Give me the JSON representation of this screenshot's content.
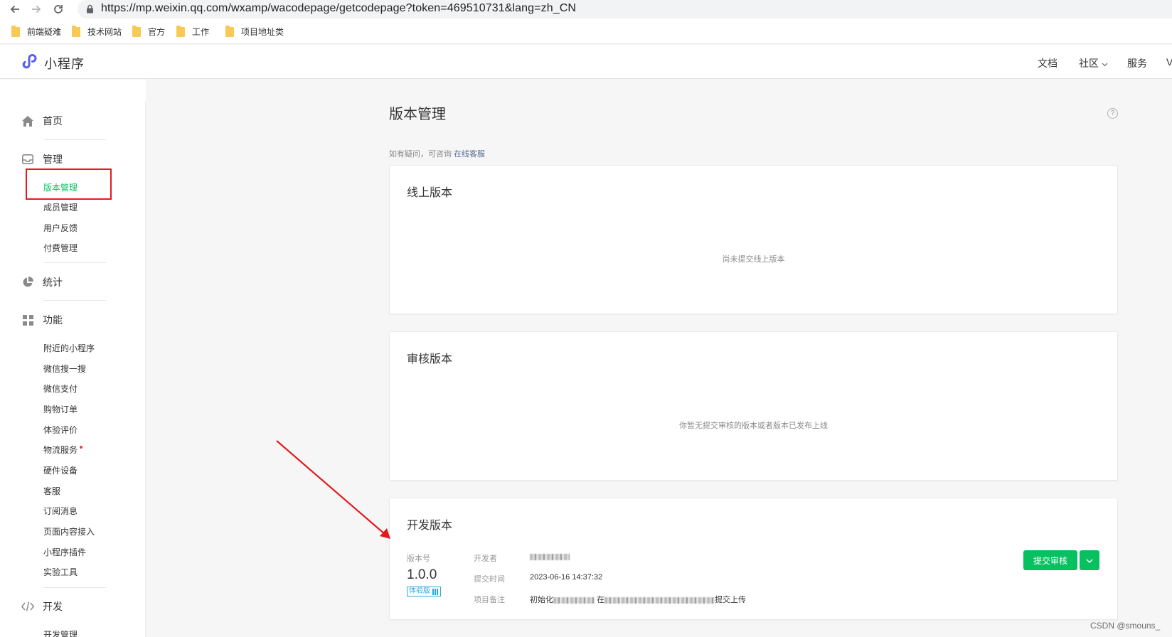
{
  "browser": {
    "url": "https://mp.weixin.qq.com/wxamp/wacodepage/getcodepage?token=469510731&lang=zh_CN",
    "bookmarks": [
      "前端疑难",
      "技术网站",
      "官方",
      "工作",
      "项目地址类"
    ]
  },
  "header": {
    "brand": "小程序",
    "nav": [
      "文档",
      "社区",
      "服务"
    ],
    "nav_overflow": "V"
  },
  "sidebar": {
    "home": "首页",
    "manage": {
      "label": "管理",
      "items": [
        "版本管理",
        "成员管理",
        "用户反馈",
        "付费管理"
      ],
      "active": "版本管理"
    },
    "stats": "统计",
    "features": {
      "label": "功能",
      "items": [
        "附近的小程序",
        "微信搜一搜",
        "微信支付",
        "购物订单",
        "体验评价",
        "物流服务",
        "硬件设备",
        "客服",
        "订阅消息",
        "页面内容接入",
        "小程序插件",
        "实验工具"
      ]
    },
    "dev": {
      "label": "开发",
      "items": [
        "开发管理"
      ]
    }
  },
  "main": {
    "title": "版本管理",
    "hint_prefix": "如有疑问，可咨询",
    "hint_link": "在线客服",
    "online": {
      "title": "线上版本",
      "empty": "尚未提交线上版本"
    },
    "review": {
      "title": "审核版本",
      "empty": "你暂无提交审核的版本或者版本已发布上线"
    },
    "develop": {
      "title": "开发版本",
      "version_label": "版本号",
      "version": "1.0.0",
      "badge": "体验版",
      "developer_label": "开发者",
      "submit_time_label": "提交时间",
      "submit_time": "2023-06-16 14:37:32",
      "note_label": "项目备注",
      "note_prefix": "初始化",
      "note_mid": "在",
      "note_suffix": "提交上传",
      "submit_button": "提交审核"
    }
  },
  "watermark": "CSDN @smouns_",
  "colors": {
    "accent_green": "#07c160",
    "link_blue": "#576b95",
    "highlight_red": "#e5191c",
    "badge_blue": "#2ea7e0"
  },
  "icons": [
    "back-arrow-icon",
    "forward-arrow-icon",
    "reload-icon",
    "lock-icon",
    "folder-icon",
    "miniprogram-logo-icon",
    "home-icon",
    "inbox-icon",
    "pie-chart-icon",
    "grid-icon",
    "code-icon",
    "help-circle-icon",
    "chevron-down-icon",
    "qr-code-icon"
  ]
}
